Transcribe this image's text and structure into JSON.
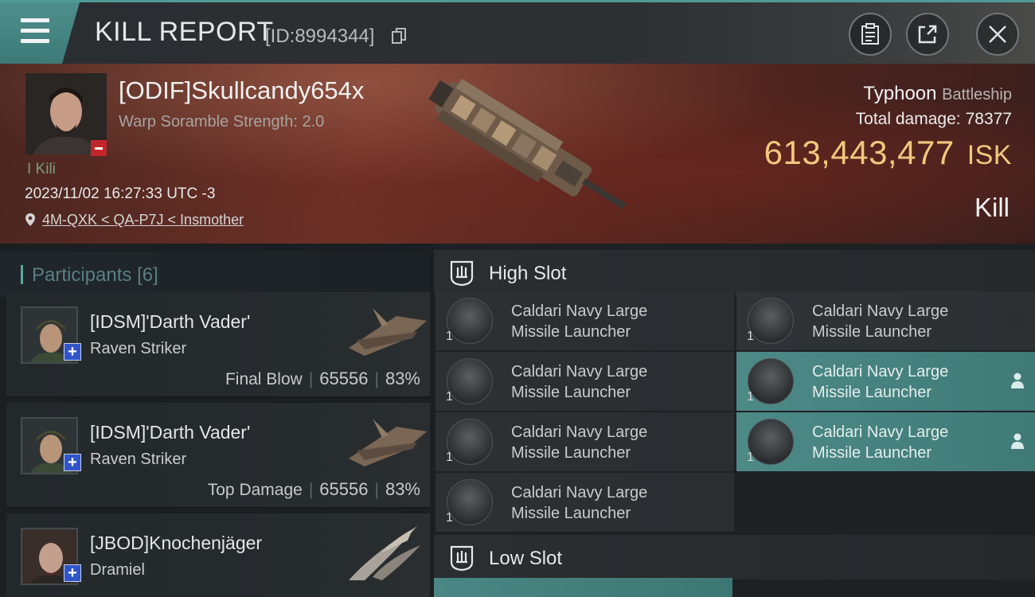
{
  "header": {
    "title": "KILL REPORT",
    "report_id": "[ID:8994344]"
  },
  "victim": {
    "name": "[ODIF]Skullcandy654x",
    "scramble": "Warp Soramble Strength: 2.0",
    "kills": "I Kili",
    "datetime": "2023/11/02 16:27:33 UTC -3",
    "location": "4M-QXK < QA-P7J < Insmother",
    "ship": "Typhoon",
    "ship_class": "Battleship",
    "damage_label": "Total damage:",
    "damage_value": "78377",
    "isk_value": "613,443,477",
    "isk_unit": "ISK",
    "result": "Kill"
  },
  "participants": {
    "label": "Participants",
    "count": "[6]",
    "items": [
      {
        "name": "[IDSM]'Darth Vader'",
        "ship": "Raven Striker",
        "tag": "Final Blow",
        "damage": "65556",
        "percent": "83%"
      },
      {
        "name": "[IDSM]'Darth Vader'",
        "ship": "Raven Striker",
        "tag": "Top Damage",
        "damage": "65556",
        "percent": "83%"
      },
      {
        "name": "[JBOD]Knochenjäger",
        "ship": "Dramiel"
      }
    ]
  },
  "fitting": {
    "high_slot": "High Slot",
    "low_slot": "Low Slot",
    "modules": [
      {
        "name": "Caldari Navy Large Missile Launcher",
        "qty": "1",
        "state": "destroyed"
      },
      {
        "name": "Caldari Navy Large Missile Launcher",
        "qty": "1",
        "state": "destroyed"
      },
      {
        "name": "Caldari Navy Large Missile Launcher",
        "qty": "1",
        "state": "destroyed"
      },
      {
        "name": "Caldari Navy Large Missile Launcher",
        "qty": "1",
        "state": "dropped"
      },
      {
        "name": "Caldari Navy Large Missile Launcher",
        "qty": "1",
        "state": "destroyed"
      },
      {
        "name": "Caldari Navy Large Missile Launcher",
        "qty": "1",
        "state": "dropped"
      },
      {
        "name": "Caldari Navy Large Missile Launcher",
        "qty": "1",
        "state": "destroyed"
      }
    ]
  },
  "icons": {
    "menu": "menu-icon",
    "copy": "copy-icon",
    "clipboard": "clipboard-icon",
    "share": "share-icon",
    "close": "close-icon",
    "location": "location-pin-icon",
    "slot": "slot-icon",
    "destroyed": "x-icon",
    "dropped": "person-icon"
  },
  "colors": {
    "accent": "#4d8f8c",
    "isk": "#f1c87d",
    "badge_minus": "#c2262a",
    "badge_plus": "#2f55c9"
  }
}
